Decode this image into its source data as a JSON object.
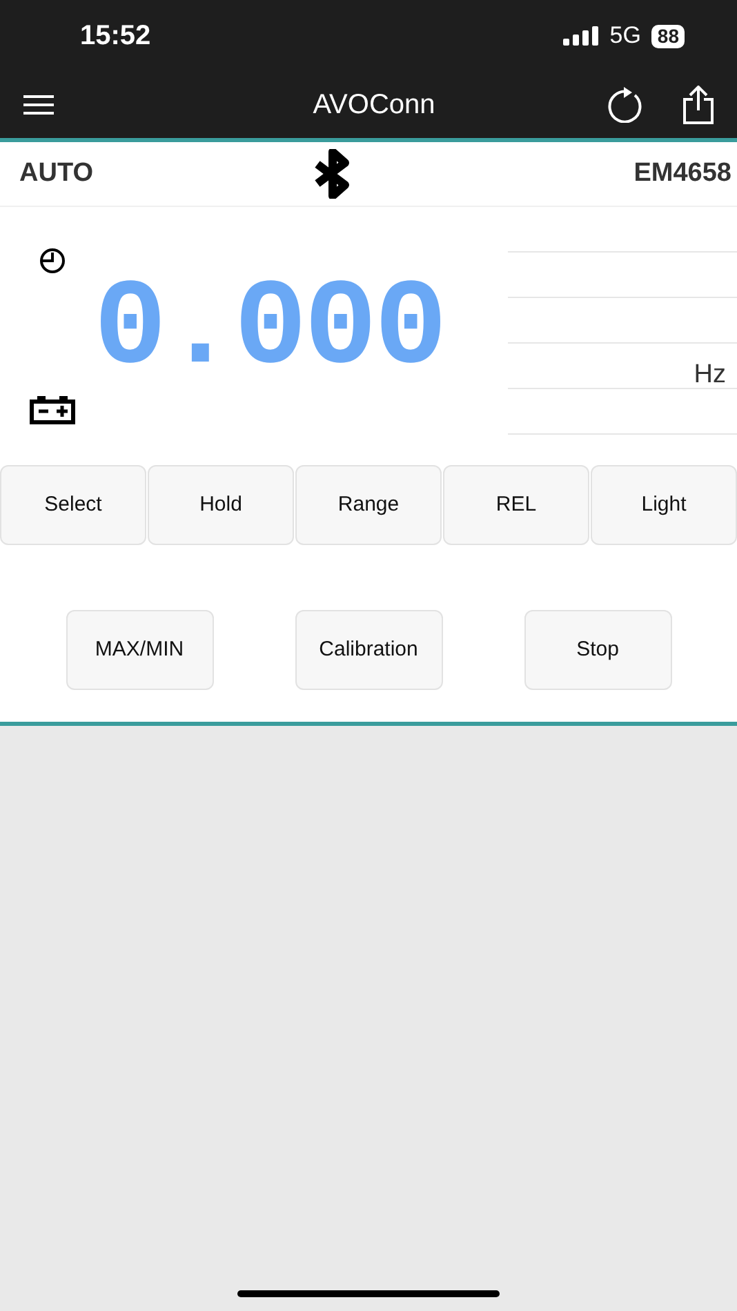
{
  "status_bar": {
    "time": "15:52",
    "network": "5G",
    "battery": "88"
  },
  "header": {
    "title": "AVOConn"
  },
  "info_row": {
    "mode": "AUTO",
    "model": "EM4658"
  },
  "display": {
    "reading": "0.000",
    "unit": "Hz"
  },
  "buttons_row_1": [
    "Select",
    "Hold",
    "Range",
    "REL",
    "Light"
  ],
  "buttons_row_2": [
    "MAX/MIN",
    "Calibration",
    "Stop"
  ]
}
